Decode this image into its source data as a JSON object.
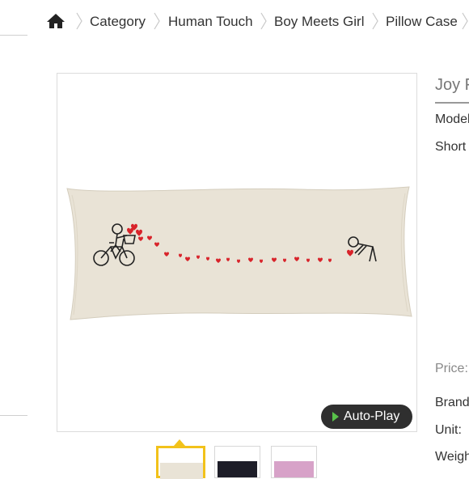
{
  "breadcrumb": {
    "home_icon": "home-icon",
    "items": [
      "Category",
      "Human Touch",
      "Boy Meets Girl",
      "Pillow Case"
    ]
  },
  "gallery": {
    "autoplay_label": "Auto-Play",
    "thumbnails": [
      "light",
      "dark",
      "pink"
    ]
  },
  "info": {
    "title": "Joy F",
    "model_label": "Model",
    "short_label": "Short",
    "price_label": "Price:",
    "brand_label": "Brand",
    "unit_label": "Unit:",
    "weight_label": "Weigh"
  },
  "colors": {
    "accent": "#f2c21a",
    "heart": "#d8232a",
    "pillow": "#e9e3d6",
    "play": "#58c24a"
  }
}
